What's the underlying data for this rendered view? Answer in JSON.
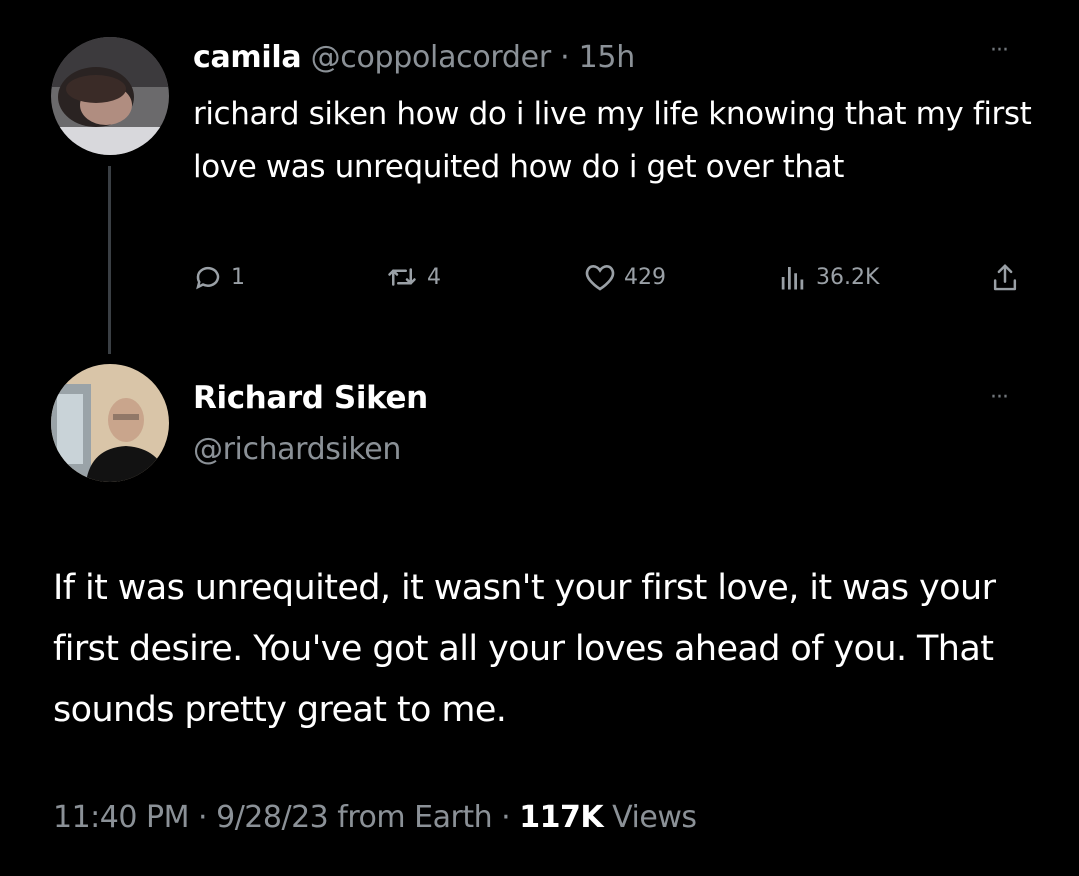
{
  "tweet": {
    "author_name": "camila",
    "handle": "@coppolacorder",
    "separator": "·",
    "time": "15h",
    "more": "···",
    "text": "richard siken how do i live my life knowing that my first love was unrequited how do i get over that",
    "replies": "1",
    "retweets": "4",
    "likes": "429",
    "views": "36.2K"
  },
  "reply": {
    "author_name": "Richard Siken",
    "handle": "@richardsiken",
    "more": "···",
    "text": "If it was unrequited, it wasn't your first love, it was your first desire. You've got all your loves ahead of you. That sounds pretty great to me.",
    "time": "11:40 PM",
    "sep1": "·",
    "date_source": "9/28/23 from Earth",
    "sep2": "·",
    "views_count": "117K",
    "views_label": "Views"
  },
  "colors": {
    "background": "#000000",
    "text": "#ffffff",
    "secondary": "#8b9197",
    "icon": "#9aa0a6",
    "thread_line": "#3a3f44"
  }
}
